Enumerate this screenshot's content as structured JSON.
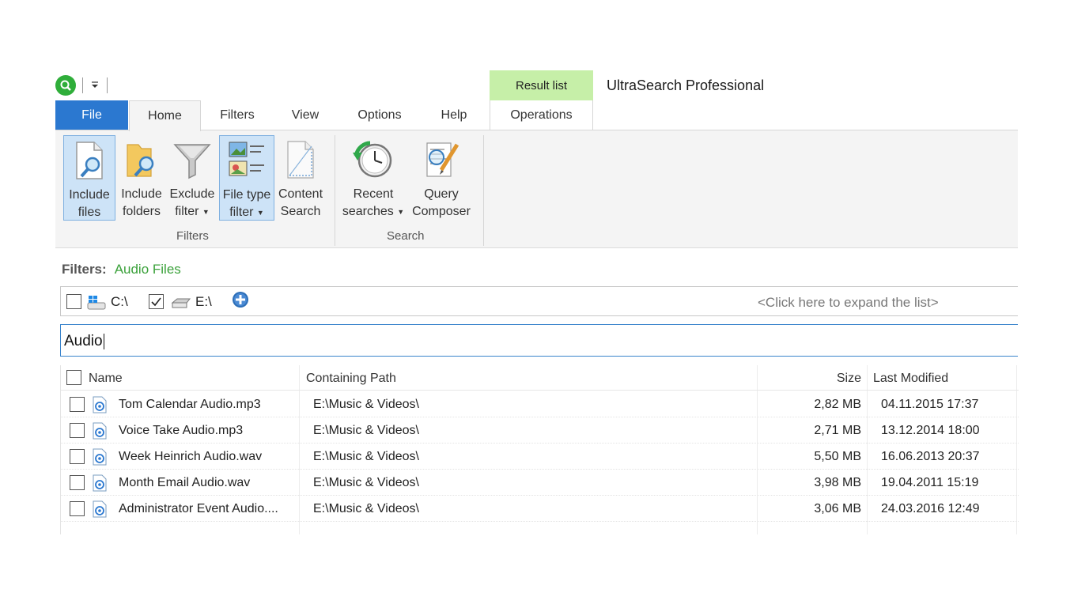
{
  "app": {
    "title": "UltraSearch Professional"
  },
  "context_tab": {
    "header": "Result list",
    "tab": "Operations"
  },
  "tabs": [
    {
      "label": "File"
    },
    {
      "label": "Home"
    },
    {
      "label": "Filters"
    },
    {
      "label": "View"
    },
    {
      "label": "Options"
    },
    {
      "label": "Help"
    }
  ],
  "ribbon": {
    "filters_group": {
      "label": "Filters",
      "buttons": [
        {
          "line1": "Include",
          "line2": "files",
          "icon": "include-files-icon",
          "selected": true
        },
        {
          "line1": "Include",
          "line2": "folders",
          "icon": "include-folders-icon",
          "selected": false
        },
        {
          "line1": "Exclude",
          "line2": "filter",
          "icon": "funnel-icon",
          "selected": false,
          "dropdown": true
        },
        {
          "line1": "File type",
          "line2": "filter",
          "icon": "file-type-icon",
          "selected": true,
          "dropdown": true
        },
        {
          "line1": "Content",
          "line2": "Search",
          "icon": "content-search-icon",
          "selected": false
        }
      ]
    },
    "search_group": {
      "label": "Search",
      "buttons": [
        {
          "line1": "Recent",
          "line2": "searches",
          "icon": "clock-icon",
          "dropdown": true
        },
        {
          "line1": "Query",
          "line2": "Composer",
          "icon": "query-composer-icon"
        }
      ]
    }
  },
  "filters": {
    "label": "Filters:",
    "value": "Audio Files"
  },
  "drives": {
    "items": [
      {
        "label": "C:\\",
        "checked": false
      },
      {
        "label": "E:\\",
        "checked": true
      }
    ],
    "expand_hint": "<Click here to expand the list>"
  },
  "search": {
    "value": "Audio"
  },
  "results": {
    "columns": {
      "name": "Name",
      "path": "Containing Path",
      "size": "Size",
      "modified": "Last Modified"
    },
    "rows": [
      {
        "name": "Tom Calendar Audio.mp3",
        "path": "E:\\Music & Videos\\",
        "size": "2,82 MB",
        "modified": "04.11.2015 17:37"
      },
      {
        "name": "Voice Take Audio.mp3",
        "path": "E:\\Music & Videos\\",
        "size": "2,71 MB",
        "modified": "13.12.2014 18:00"
      },
      {
        "name": "Week Heinrich Audio.wav",
        "path": "E:\\Music & Videos\\",
        "size": "5,50 MB",
        "modified": "16.06.2013 20:37"
      },
      {
        "name": "Month Email Audio.wav",
        "path": "E:\\Music & Videos\\",
        "size": "3,98 MB",
        "modified": "19.04.2011 15:19"
      },
      {
        "name": "Administrator Event Audio....",
        "path": "E:\\Music & Videos\\",
        "size": "3,06 MB",
        "modified": "24.03.2016 12:49"
      }
    ]
  },
  "colors": {
    "file_tab": "#2b78d0",
    "context_header": "#c6efa8",
    "filter_value": "#3aa13a",
    "search_border": "#3a84cc"
  }
}
